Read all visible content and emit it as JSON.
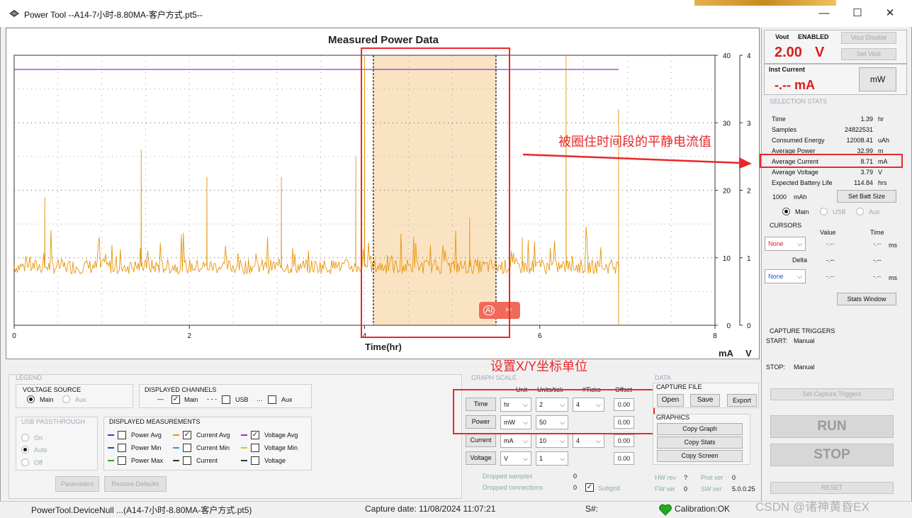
{
  "window": {
    "title": "Power Tool --A14-7小时-8.80MA-客户方式.pt5--",
    "minimize": "—",
    "maximize": "☐",
    "close": "✕"
  },
  "graph": {
    "title": "Measured Power Data",
    "xlabel": "Time(hr)",
    "unit_ma": "mA",
    "unit_v": "V",
    "ai_badge": "AI"
  },
  "chart_data": {
    "type": "line",
    "title": "Measured Power Data",
    "xlabel": "Time(hr)",
    "xlim": [
      0,
      8
    ],
    "x_ticks": [
      "0",
      "2",
      "4",
      "6",
      "8"
    ],
    "y_left_label": "mA",
    "y_left_lim": [
      0,
      40
    ],
    "y_left_ticks": [
      "0",
      "10",
      "20",
      "30",
      "40"
    ],
    "y_right_label": "V",
    "y_right_lim": [
      0,
      4
    ],
    "y_right_ticks": [
      "0",
      "1",
      "2",
      "3",
      "4"
    ],
    "selection_range_hr": [
      4.1,
      5.5
    ],
    "cursor_hr": [
      4.1,
      5.5
    ],
    "series": [
      {
        "name": "Voltage Avg",
        "color": "#9b30c8",
        "axis": "right",
        "x": [
          0,
          6.9
        ],
        "y": [
          3.79,
          3.79
        ]
      },
      {
        "name": "Current Avg",
        "color": "#e8960e",
        "axis": "left",
        "baseline": 8.7,
        "spikes_x": [
          0.35,
          1.45,
          2.2,
          3.05,
          3.9,
          4.0,
          5.2,
          5.8,
          6.3,
          6.9
        ],
        "spikes_y": [
          19,
          26,
          22,
          22,
          25,
          40,
          16,
          13,
          40,
          32
        ]
      }
    ]
  },
  "annotations": {
    "selection_note": "被圈住时间段的平静电流值",
    "axis_note": "设置X/Y坐标单位"
  },
  "sidebar": {
    "vout_label": "Vout",
    "vout_state": "ENABLED",
    "vout_value": "2.00",
    "vout_unit": "V",
    "vout_disable_btn": "Vout Disable",
    "set_vout_btn": "Set Vout",
    "inst_current_label": "Inst Current",
    "inst_current_value": "-.-- mA",
    "mw_btn": "mW",
    "selection_stats_title": "SELECTION STATS",
    "stats": [
      {
        "label": "Time",
        "value": "1.39",
        "unit": "hr"
      },
      {
        "label": "Samples",
        "value": "24822531",
        "unit": ""
      },
      {
        "label": "Consumed Energy",
        "value": "12008.41",
        "unit": "uAh"
      },
      {
        "label": "Average Power",
        "value": "32.99",
        "unit": "m"
      },
      {
        "label": "Average Current",
        "value": "8.71",
        "unit": "mA"
      },
      {
        "label": "Average Voltage",
        "value": "3.79",
        "unit": "V"
      },
      {
        "label": "Expected Battery Life",
        "value": "114.84",
        "unit": "hrs"
      }
    ],
    "batt_size": "1000",
    "batt_unit": "mAh",
    "set_batt_btn": "Set Batt Size",
    "radio_main": "Main",
    "radio_usb": "USB",
    "radio_aux": "Aux",
    "cursors_title": "CURSORS",
    "col_value": "Value",
    "col_time": "Time",
    "cursor1_select": "None",
    "cursor1_value": "-.--",
    "cursor1_time": "-.--",
    "cursor1_unit": "ms",
    "delta_label": "Delta",
    "delta_value": "-.--",
    "delta_time": "-.--",
    "cursor2_select": "None",
    "cursor2_value": "-.--",
    "cursor2_time": "-.--",
    "cursor2_unit": "ms",
    "stats_window_btn": "Stats Window",
    "capture_triggers_title": "CAPTURE TRIGGERS",
    "start_label": "START:",
    "start_value": "Manual",
    "stop_label": "STOP:",
    "stop_value": "Manual",
    "set_capture_btn": "Set Capture Triggers",
    "run_btn": "RUN",
    "stop_btn": "STOP",
    "reset_btn": "RESET"
  },
  "legend": {
    "title": "LEGEND",
    "voltage_source_title": "VOLTAGE SOURCE",
    "vs_main": "Main",
    "vs_aux": "Aux",
    "displayed_channels_title": "DISPLAYED CHANNELS",
    "ch_main": "Main",
    "ch_usb": "USB",
    "ch_aux": "Aux",
    "usb_passthrough_title": "USB PASSTHROUGH",
    "usb_on": "On",
    "usb_auto": "Auto",
    "usb_off": "Off",
    "displayed_measurements_title": "DISPLAYED MEASUREMENTS",
    "m_power_avg": "Power Avg",
    "m_power_min": "Power Min",
    "m_power_max": "Power Max",
    "m_current_avg": "Current Avg",
    "m_current_min": "Current Min",
    "m_current": "Current",
    "m_voltage_avg": "Voltage Avg",
    "m_voltage_min": "Voltage Min",
    "m_voltage": "Voltage",
    "parameters_btn": "Parameters",
    "restore_btn": "Restore Defaults"
  },
  "graph_scale": {
    "title": "GRAPH SCALE",
    "col_unit": "Unit",
    "col_units_tick": "Units/tick",
    "col_ticks": "#Ticks",
    "col_offset": "Offset",
    "rows": [
      {
        "label": "Time",
        "unit": "hr",
        "units_tick": "2",
        "ticks": "4",
        "offset": "0.00"
      },
      {
        "label": "Power",
        "unit": "mW",
        "units_tick": "50",
        "ticks": "",
        "offset": "0.00"
      },
      {
        "label": "Current",
        "unit": "mA",
        "units_tick": "10",
        "ticks": "4",
        "offset": "0.00"
      },
      {
        "label": "Voltage",
        "unit": "V",
        "units_tick": "1",
        "ticks": "",
        "offset": "0.00"
      }
    ],
    "dropped_samples_label": "Dropped samples",
    "dropped_samples_value": "0",
    "dropped_conn_label": "Dropped connections",
    "dropped_conn_value": "0",
    "subgrid_label": "Subgrid"
  },
  "data_panel": {
    "title": "DATA",
    "capture_file_title": "CAPTURE FILE",
    "open_btn": "Open",
    "save_btn": "Save",
    "export_btn": "Export",
    "graphics_title": "GRAPHICS",
    "copy_graph_btn": "Copy Graph",
    "copy_stats_btn": "Copy Stats",
    "copy_screen_btn": "Copy Screen",
    "hw_rev_label": "HW rev",
    "hw_rev_value": "?",
    "prot_ver_label": "Prot ver",
    "prot_ver_value": "0",
    "fw_ver_label": "FW ver",
    "fw_ver_value": "0",
    "sw_ver_label": "SW ver",
    "sw_ver_value": "5.0.0.25"
  },
  "statusbar": {
    "device": "PowerTool.DeviceNull ...(A14-7小时-8.80MA-客户方式.pt5)",
    "capture_date": "Capture date: 11/08/2024 11:07:21",
    "serial": "S#:",
    "calibration": "Calibration:OK",
    "watermark": "CSDN @诸神黄昏EX"
  },
  "colors": {
    "current": "#e8960e",
    "voltage": "#9b30c8",
    "selection_fill": "#fae3c2",
    "annotation_red": "#e8282a",
    "vout_red": "#d81e1e",
    "calibration_green": "#22aa22"
  }
}
